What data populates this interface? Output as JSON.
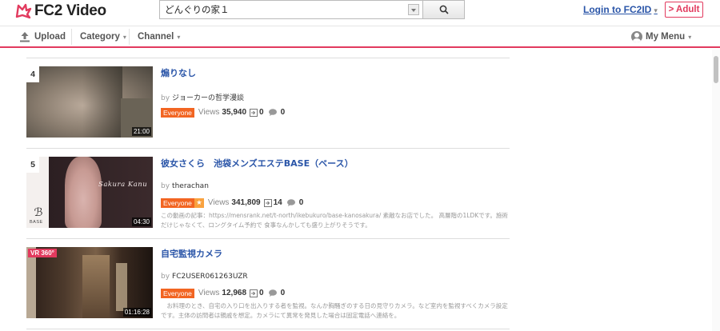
{
  "header": {
    "brand": "FC2 Video",
    "search": {
      "value": "どんぐりの家１"
    },
    "login_label": "Login to FC2ID",
    "login_caret": "▾",
    "adult_label": "> Adult"
  },
  "nav": {
    "upload": "Upload",
    "category": "Category",
    "channel": "Channel",
    "my_menu": "My Menu",
    "caret": "▾"
  },
  "colors": {
    "accent": "#e23a5e",
    "link": "#2a55a8",
    "badge": "#f26522",
    "badge_star": "#f9a23f"
  },
  "videos": [
    {
      "rank": "4",
      "duration": "21:00",
      "title": "煽りなし",
      "by_label": "by",
      "user": "ジョーカーの哲学漫談",
      "rating": "Everyone",
      "views_label": "Views",
      "views": "35,940",
      "clips": "0",
      "comments": "0",
      "description": ""
    },
    {
      "rank": "5",
      "duration": "04:30",
      "thumb_text": "Sakura Kanu",
      "thumb_logo": "BASE",
      "title": "彼女さくら　池袋メンズエステBASE（ベース）",
      "by_label": "by",
      "user": "therachan",
      "rating": "Everyone",
      "rating_star": "★",
      "views_label": "Views",
      "views": "341,809",
      "clips": "14",
      "comments": "0",
      "description": "この動画の記事：https://mensrank.net/t-north/ikebukuro/base-kanosakura/ 素敵なお店でした。 高層階の1LDKです。施術だけじゃなくて、ロングタイム予約で 食事なんかしても盛り上がりそうです。"
    },
    {
      "vr": "VR 360°",
      "duration": "01:16:28",
      "title": "自宅監視カメラ",
      "by_label": "by",
      "user": "FC2USER061263UZR",
      "rating": "Everyone",
      "views_label": "Views",
      "views": "12,968",
      "clips": "0",
      "comments": "0",
      "description": "　お料理のとき、自宅の入り口を出入りする者を監視。なんか胸騒ぎのする日の見守りカメラ。など室内を監視すべくカメラ設定です。主体の訪問者は親戚を想定。カメラにて異常を発見した場合は固定電話へ連絡を。"
    }
  ]
}
